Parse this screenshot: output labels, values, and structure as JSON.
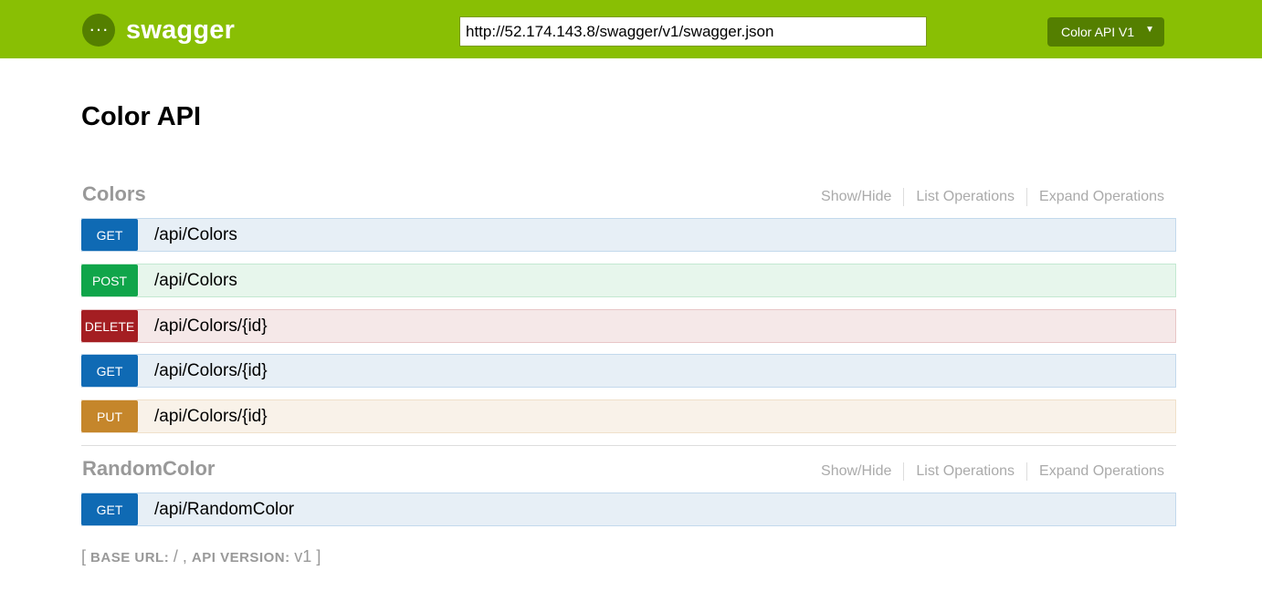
{
  "header": {
    "logo_text": "swagger",
    "url_value": "http://52.174.143.8/swagger/v1/swagger.json",
    "api_select": "Color API V1"
  },
  "page_title": "Color API",
  "actions": {
    "show_hide": "Show/Hide",
    "list_operations": "List Operations",
    "expand_operations": "Expand Operations"
  },
  "resources": [
    {
      "name": "Colors",
      "operations": [
        {
          "method": "GET",
          "path": "/api/Colors"
        },
        {
          "method": "POST",
          "path": "/api/Colors"
        },
        {
          "method": "DELETE",
          "path": "/api/Colors/{id}"
        },
        {
          "method": "GET",
          "path": "/api/Colors/{id}"
        },
        {
          "method": "PUT",
          "path": "/api/Colors/{id}"
        }
      ]
    },
    {
      "name": "RandomColor",
      "operations": [
        {
          "method": "GET",
          "path": "/api/RandomColor"
        }
      ]
    }
  ],
  "footer": {
    "open_bracket": "[",
    "base_url_label": "base url",
    "base_url_value": "/",
    "api_version_label": "api version",
    "api_version_value": "v1",
    "close_bracket": "]"
  },
  "colors": {
    "header_bg": "#89bf04",
    "get": "#0f6ab4",
    "post": "#10a54a",
    "delete": "#a41e22",
    "put": "#c5862b"
  }
}
